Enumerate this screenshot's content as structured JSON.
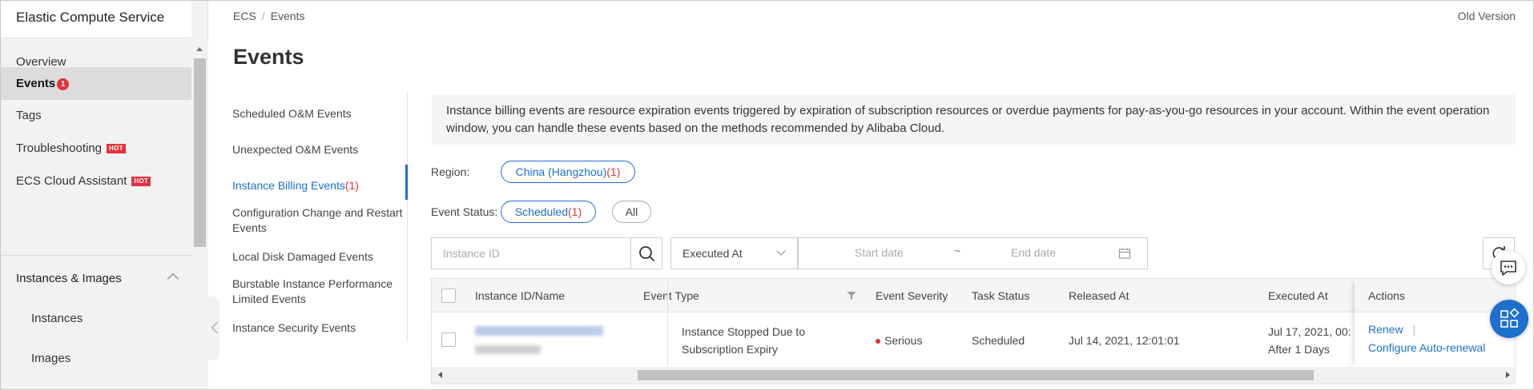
{
  "sidebar": {
    "title": "Elastic Compute Service",
    "items": [
      {
        "label": "Overview"
      },
      {
        "label": "Events",
        "badge": "1"
      },
      {
        "label": "Tags"
      },
      {
        "label": "Troubleshooting",
        "tag": "HOT"
      },
      {
        "label": "ECS Cloud Assistant",
        "tag": "HOT"
      }
    ],
    "group": {
      "label": "Instances & Images",
      "expanded": true
    },
    "sub_items": [
      {
        "label": "Instances"
      },
      {
        "label": "Images"
      }
    ]
  },
  "header": {
    "breadcrumb": [
      "ECS",
      "Events"
    ],
    "breadcrumb_sep": "/",
    "old_version": "Old Version",
    "title": "Events"
  },
  "subnav": {
    "items": [
      {
        "label": "Scheduled O&M Events"
      },
      {
        "label": "Unexpected O&M Events"
      },
      {
        "label": "Instance Billing Events",
        "count": "(1)",
        "active": true
      },
      {
        "label": "Configuration Change and Restart Events"
      },
      {
        "label": "Local Disk Damaged Events"
      },
      {
        "label": "Burstable Instance Performance Limited Events"
      },
      {
        "label": "Instance Security Events"
      }
    ]
  },
  "notice": "Instance billing events are resource expiration events triggered by expiration of subscription resources or overdue payments for pay-as-you-go resources in your account. Within the event operation window, you can handle these events based on the methods recommended by Alibaba Cloud.",
  "filters": {
    "region_label": "Region:",
    "region_value": "China (Hangzhou)",
    "region_count": "(1)",
    "status_label": "Event Status:",
    "status_value": "Scheduled",
    "status_count": "(1)",
    "status_all": "All",
    "instance_placeholder": "Instance ID",
    "time_select": "Executed At",
    "start_placeholder": "Start date",
    "range_sep": "~",
    "end_placeholder": "End date"
  },
  "table": {
    "columns": [
      "Instance ID/Name",
      "Event Type",
      "Event Severity",
      "Task Status",
      "Released At",
      "Executed At",
      "Actions"
    ],
    "rows": [
      {
        "event_type": "Instance Stopped Due to Subscription Expiry",
        "severity": "Serious",
        "task_status": "Scheduled",
        "released_at": "Jul 14, 2021, 12:01:01",
        "executed_at": "Jul 17, 2021, 00:",
        "executed_note": "After 1 Days",
        "action_renew": "Renew",
        "action_sep": "|",
        "action_auto": "Configure Auto-renewal"
      }
    ]
  },
  "colors": {
    "accent": "#1d6fcf",
    "danger": "#e0323a",
    "sidebar_bg": "#f2f2f2"
  },
  "icons": [
    "search-icon",
    "chevron-down-icon",
    "calendar-icon",
    "refresh-icon",
    "chat-icon",
    "apps-icon",
    "chevron-up-icon",
    "chevron-left-icon",
    "filter-icon"
  ]
}
